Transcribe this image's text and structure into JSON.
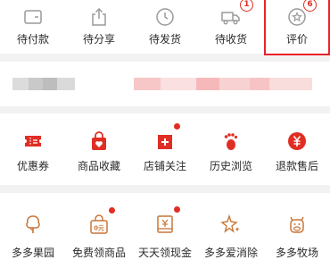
{
  "orders": {
    "items": [
      {
        "label": "待付款",
        "icon": "wallet-icon"
      },
      {
        "label": "待分享",
        "icon": "share-icon"
      },
      {
        "label": "待发货",
        "icon": "clock-icon"
      },
      {
        "label": "待收货",
        "icon": "truck-icon",
        "badge": "1"
      },
      {
        "label": "评价",
        "icon": "star-bubble-icon",
        "badge": "6"
      }
    ]
  },
  "tools": {
    "items": [
      {
        "label": "优惠券",
        "icon": "coupon-icon"
      },
      {
        "label": "商品收藏",
        "icon": "bag-heart-icon"
      },
      {
        "label": "店铺关注",
        "icon": "store-plus-icon",
        "dot": true
      },
      {
        "label": "历史浏览",
        "icon": "footprint-icon"
      },
      {
        "label": "退款售后",
        "icon": "yen-icon"
      }
    ]
  },
  "apps": {
    "items": [
      {
        "label": "多多果园",
        "icon": "tree-icon"
      },
      {
        "label": "免费领商品",
        "icon": "free-bag-icon",
        "dot": true
      },
      {
        "label": "天天领现金",
        "icon": "cash-icon",
        "dot": true
      },
      {
        "label": "多多爱消除",
        "icon": "sparkle-star-icon"
      },
      {
        "label": "多多牧场",
        "icon": "cow-icon"
      }
    ]
  },
  "colors": {
    "accent": "#e02e24",
    "text": "#2a2a2a",
    "icon_gray": "#9a9a9a",
    "icon_orange": "#c8773a",
    "background": "#f2f2f2"
  }
}
